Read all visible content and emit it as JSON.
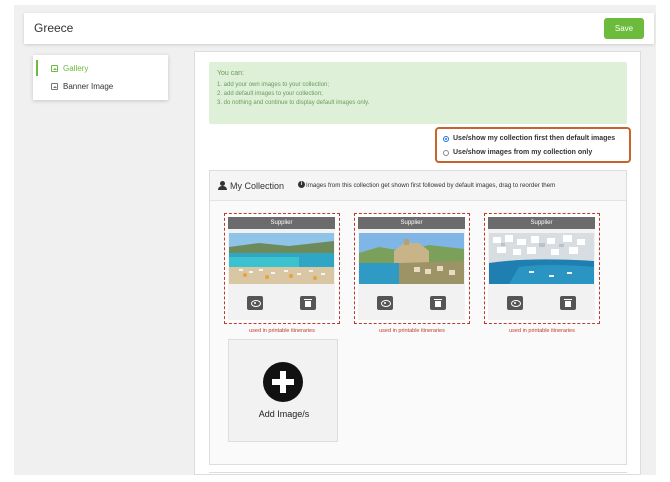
{
  "header": {
    "title": "Greece",
    "save_label": "Save"
  },
  "sidebar": {
    "items": [
      {
        "label": "Gallery",
        "icon": "image-icon",
        "active": true
      },
      {
        "label": "Banner Image",
        "icon": "image-icon",
        "active": false
      }
    ]
  },
  "info": {
    "title": "You can:",
    "lines": [
      "1. add your own images to your collection;",
      "2. add default images to your collection;",
      "3. do nothing and continue to display default images only."
    ]
  },
  "display_options": {
    "selected": 0,
    "options": [
      "Use/show my collection first then default images",
      "Use/show images from my collection only"
    ]
  },
  "collection": {
    "title": "My Collection",
    "note": "Images from this collection get shown first followed by default images, drag to reorder them",
    "cards": [
      {
        "header": "Supplier",
        "footer": "used in printable itineraries"
      },
      {
        "header": "Supplier",
        "footer": "used in printable itineraries"
      },
      {
        "header": "Supplier",
        "footer": "used in printable itineraries"
      }
    ],
    "add_label": "Add Image/s"
  },
  "colors": {
    "accent": "#6cbb3c",
    "highlight_border": "#c8642b",
    "dashed_border": "#c0392b"
  }
}
